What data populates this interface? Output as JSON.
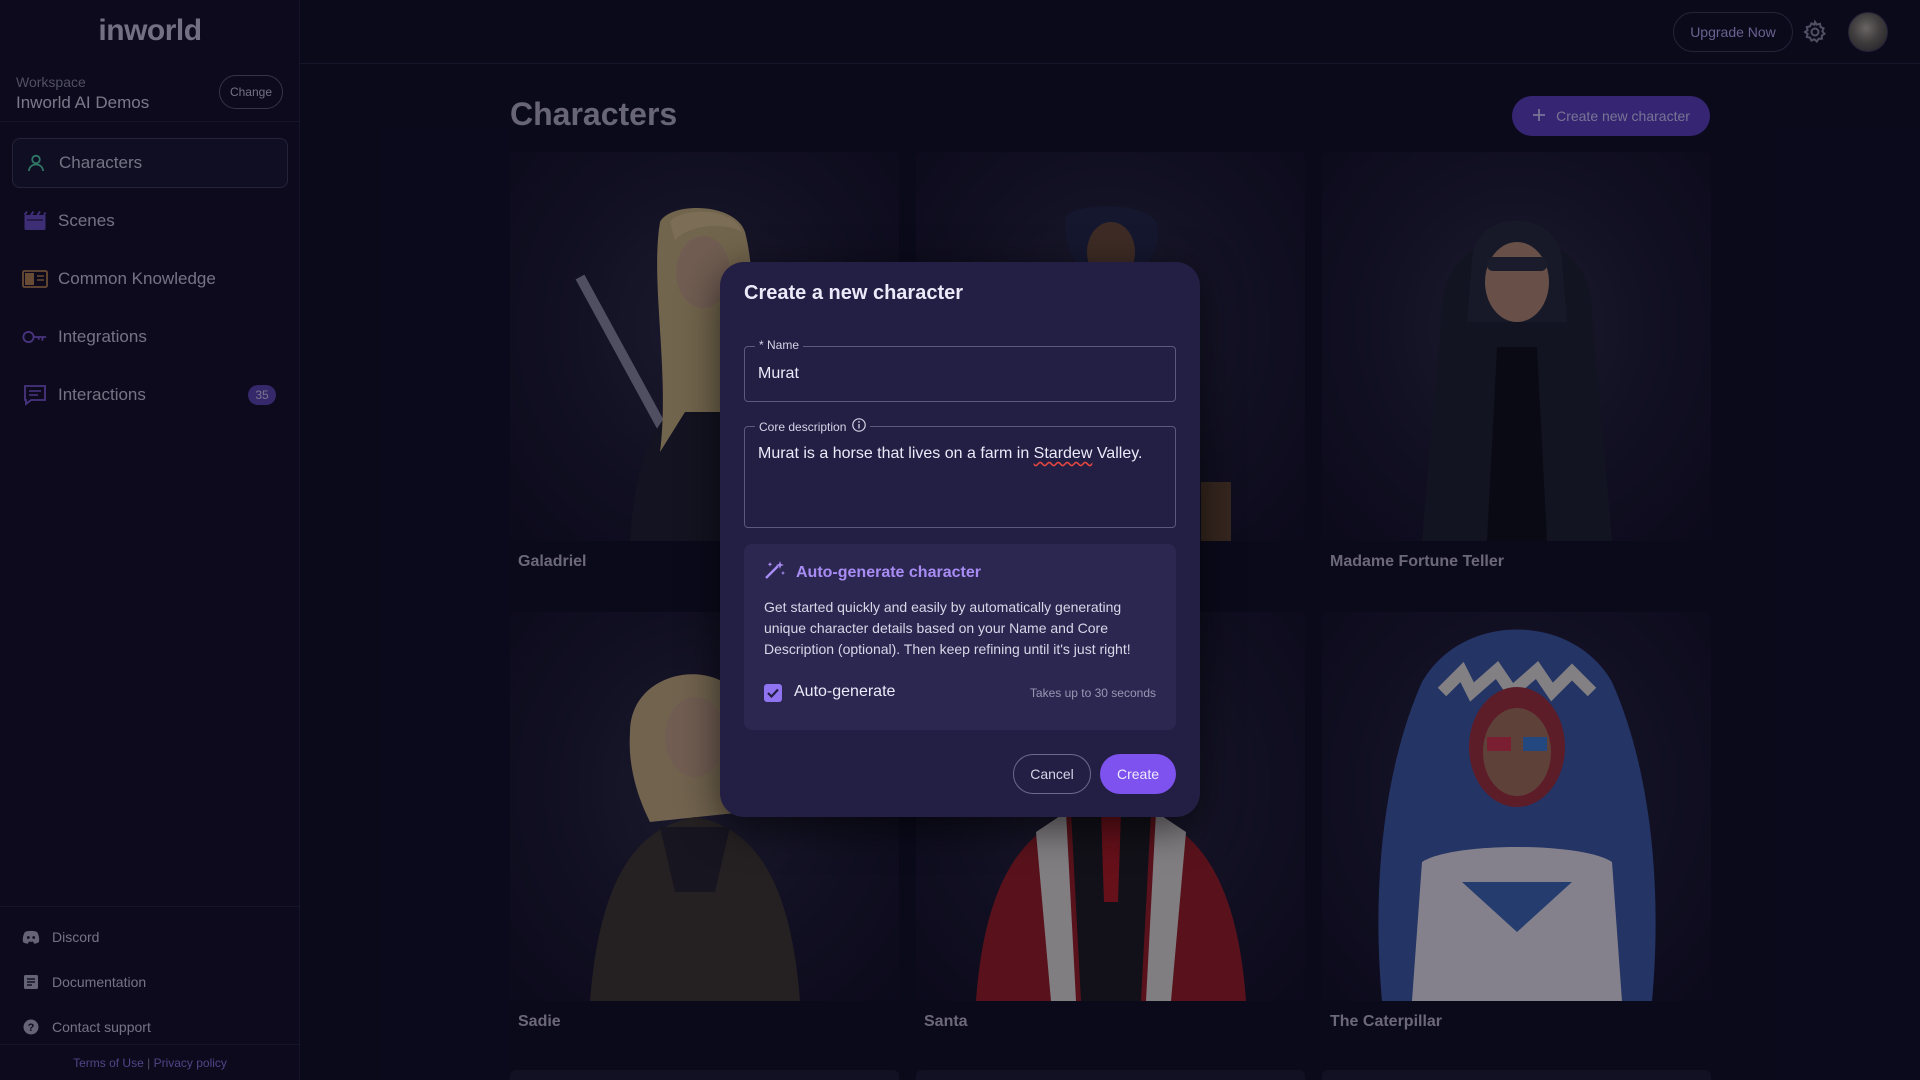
{
  "app": {
    "logo": "inworld"
  },
  "workspace": {
    "label": "Workspace",
    "name": "Inworld AI Demos",
    "change_label": "Change"
  },
  "sidebar": {
    "items": [
      {
        "label": "Characters",
        "icon": "person-icon",
        "active": true
      },
      {
        "label": "Scenes",
        "icon": "clapperboard-icon"
      },
      {
        "label": "Common Knowledge",
        "icon": "book-icon"
      },
      {
        "label": "Integrations",
        "icon": "key-icon"
      },
      {
        "label": "Interactions",
        "icon": "chat-icon",
        "badge": "35"
      }
    ],
    "bottom_links": [
      {
        "label": "Discord",
        "icon": "discord-icon"
      },
      {
        "label": "Documentation",
        "icon": "document-icon"
      },
      {
        "label": "Contact support",
        "icon": "help-icon"
      }
    ],
    "legal": {
      "terms": "Terms of Use",
      "separator": "|",
      "privacy": "Privacy policy"
    }
  },
  "topbar": {
    "upgrade_label": "Upgrade Now"
  },
  "main": {
    "title": "Characters",
    "create_button_label": "Create new character",
    "characters": [
      {
        "name": "Galadriel"
      },
      {
        "name": ""
      },
      {
        "name": "Madame Fortune Teller"
      },
      {
        "name": "Sadie"
      },
      {
        "name": "Santa"
      },
      {
        "name": "The Caterpillar"
      }
    ]
  },
  "modal": {
    "title": "Create a new character",
    "name_field": {
      "label": "* Name",
      "value": "Murat"
    },
    "description_field": {
      "label": "Core description",
      "value_before": "Murat is a horse that lives on a farm in ",
      "value_misspelled": "Stardew",
      "value_after": " Valley."
    },
    "autogen": {
      "title": "Auto-generate character",
      "description": "Get started quickly and easily by automatically generating unique character details based on your Name and Core Description (optional). Then keep refining until it's just right!",
      "checkbox_label": "Auto-generate",
      "checked": true,
      "hint": "Takes up to 30 seconds"
    },
    "cancel_label": "Cancel",
    "create_label": "Create"
  },
  "colors": {
    "accent": "#7d52ee",
    "background": "#0e0d22",
    "modal": "#231e44"
  }
}
